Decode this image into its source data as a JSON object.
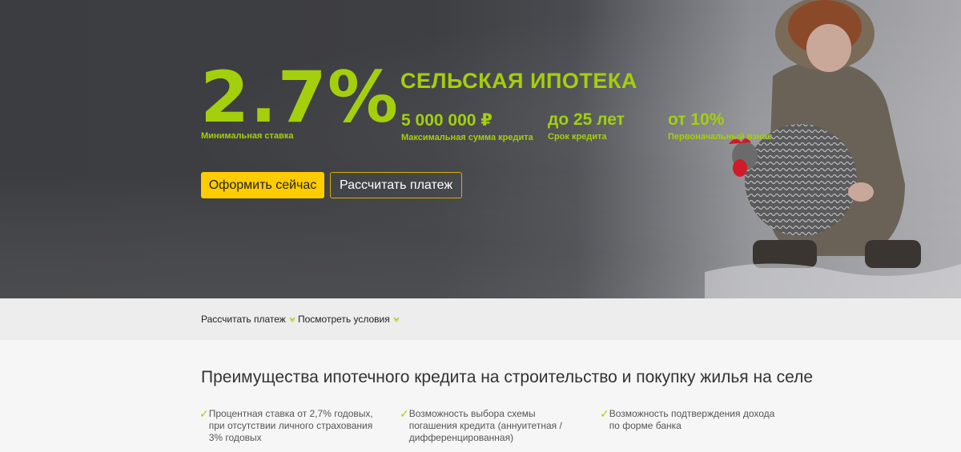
{
  "hero": {
    "rate": "2.7%",
    "rate_caption": "Минимальная ставка",
    "title": "СЕЛЬСКАЯ ИПОТЕКА",
    "stats": [
      {
        "value": "5 000 000 ₽",
        "label": "Максимальная сумма кредита"
      },
      {
        "value": "до 25 лет",
        "label": "Срок кредита"
      },
      {
        "value": "от 10%",
        "label": "Первоначальный взнос"
      }
    ],
    "primary_button": "Оформить сейчас",
    "secondary_button": "Рассчитать платеж"
  },
  "subnav": {
    "items": [
      {
        "label": "Рассчитать платеж"
      },
      {
        "label": "Посмотреть условия"
      }
    ]
  },
  "advantages": {
    "title": "Преимущества ипотечного кредита на строительство и покупку жилья на селе",
    "items": [
      {
        "text": "Процентная ставка от 2,7% годовых, при отсутствии личного страхования 3% годовых"
      },
      {
        "text": "Возможность выбора схемы погашения кредита (аннуитетная / дифференцированная)"
      },
      {
        "text": "Возможность подтверждения дохода по форме банка"
      }
    ],
    "check_icon": "✓"
  },
  "colors": {
    "accent_green": "#a4cf0c",
    "button_yellow": "#fecc00",
    "hero_dark": "#3e3f43"
  }
}
